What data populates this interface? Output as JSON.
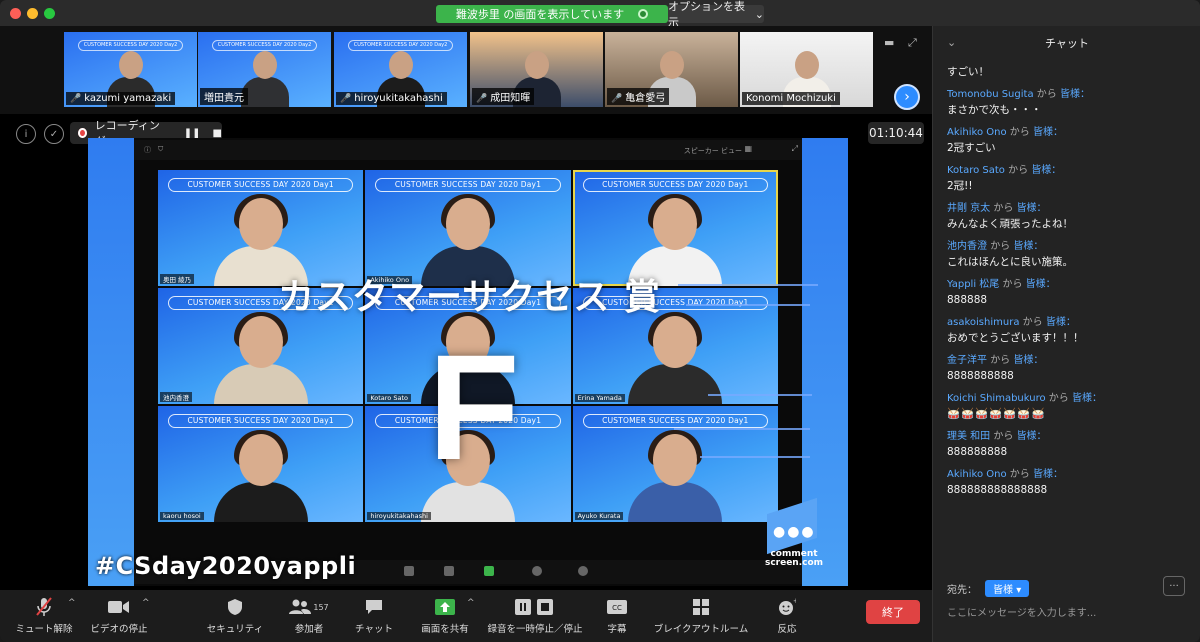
{
  "titlebar": {
    "share_banner": "難波歩里 の画面を表示しています",
    "options_label": "オプションを表示"
  },
  "thumbnails": [
    {
      "name": "kazumi yamazaki",
      "muted": true,
      "banner": "CUSTOMER SUCCESS DAY 2020 Day2"
    },
    {
      "name": "増田貴元",
      "muted": false,
      "banner": "CUSTOMER SUCCESS DAY 2020 Day2"
    },
    {
      "name": "hiroyukitakahashi",
      "muted": true,
      "banner": "CUSTOMER SUCCESS DAY 2020 Day2"
    },
    {
      "name": "成田知暉",
      "muted": true,
      "banner": ""
    },
    {
      "name": "亀倉愛弓",
      "muted": true,
      "banner": ""
    },
    {
      "name": "Konomi Mochizuki",
      "muted": false,
      "banner": ""
    }
  ],
  "recording": {
    "label": "レコーディング...",
    "timer": "01:10:44"
  },
  "shared_screen": {
    "view_label": "スピーカー ビュー",
    "cells": [
      {
        "banner": "CUSTOMER SUCCESS DAY 2020 Day1",
        "tag": "奥田 綾乃",
        "active": false
      },
      {
        "banner": "CUSTOMER SUCCESS DAY 2020 Day1",
        "tag": "Akihiko Ono",
        "active": false
      },
      {
        "banner": "CUSTOMER SUCCESS DAY 2020 Day1",
        "tag": "",
        "active": true
      },
      {
        "banner": "CUSTOMER SUCCESS DAY 2020 Day1",
        "tag": "池内香澄",
        "active": false
      },
      {
        "banner": "CUSTOMER SUCCESS DAY 2020 Day1",
        "tag": "Kotaro Sato",
        "active": false
      },
      {
        "banner": "CUSTOMER SUCCESS DAY 2020 Day1",
        "tag": "Erina Yamada",
        "active": false
      },
      {
        "banner": "CUSTOMER SUCCESS DAY 2020 Day1",
        "tag": "kaoru hosoi",
        "active": false
      },
      {
        "banner": "CUSTOMER SUCCESS DAY 2020 Day1",
        "tag": "hiroyukitakahashi",
        "active": false
      },
      {
        "banner": "CUSTOMER SUCCESS DAY 2020 Day1",
        "tag": "Ayuko Kurata",
        "active": false
      }
    ],
    "overlay_title": "カスタマーサクセス 賞",
    "overlay_letter": "F",
    "hashtag": "#CSday2020yappli",
    "logo_text_1": "comment",
    "logo_text_2": "screen.com"
  },
  "toolbar": {
    "mute": "ミュート解除",
    "video": "ビデオの停止",
    "security": "セキュリティ",
    "participants": "参加者",
    "participants_count": "157",
    "chat": "チャット",
    "share": "画面を共有",
    "record": "録音を一時停止／停止",
    "cc": "字幕",
    "breakout": "ブレイクアウトルーム",
    "reactions": "反応",
    "end": "終了"
  },
  "chat": {
    "title": "チャット",
    "from_word": "から",
    "to_word": "皆様：",
    "first_text": "すごい！",
    "messages": [
      {
        "sender": "Tomonobu Sugita",
        "text": "まさかで次も・・・"
      },
      {
        "sender": "Akihiko Ono",
        "text": "2冠すごい"
      },
      {
        "sender": "Kotaro Sato",
        "text": "2冠!!"
      },
      {
        "sender": "井剛 京太",
        "text": "みんなよく頑張ったよね！"
      },
      {
        "sender": "池内香澄",
        "text": "これはほんとに良い施策。"
      },
      {
        "sender": "Yappli 松尾",
        "text": "888888"
      },
      {
        "sender": "asakoishimura",
        "text": "おめでとうございます！！！"
      },
      {
        "sender": "金子洋平",
        "text": "8888888888"
      },
      {
        "sender": "Koichi Shimabukuro",
        "text": "🥁🥁🥁🥁🥁🥁🥁"
      },
      {
        "sender": "理美 和田",
        "text": "888888888"
      },
      {
        "sender": "Akihiko Ono",
        "text": "888888888888888"
      }
    ],
    "to_label": "宛先：",
    "to_value": "皆様",
    "input_placeholder": "ここにメッセージを入力します..."
  }
}
